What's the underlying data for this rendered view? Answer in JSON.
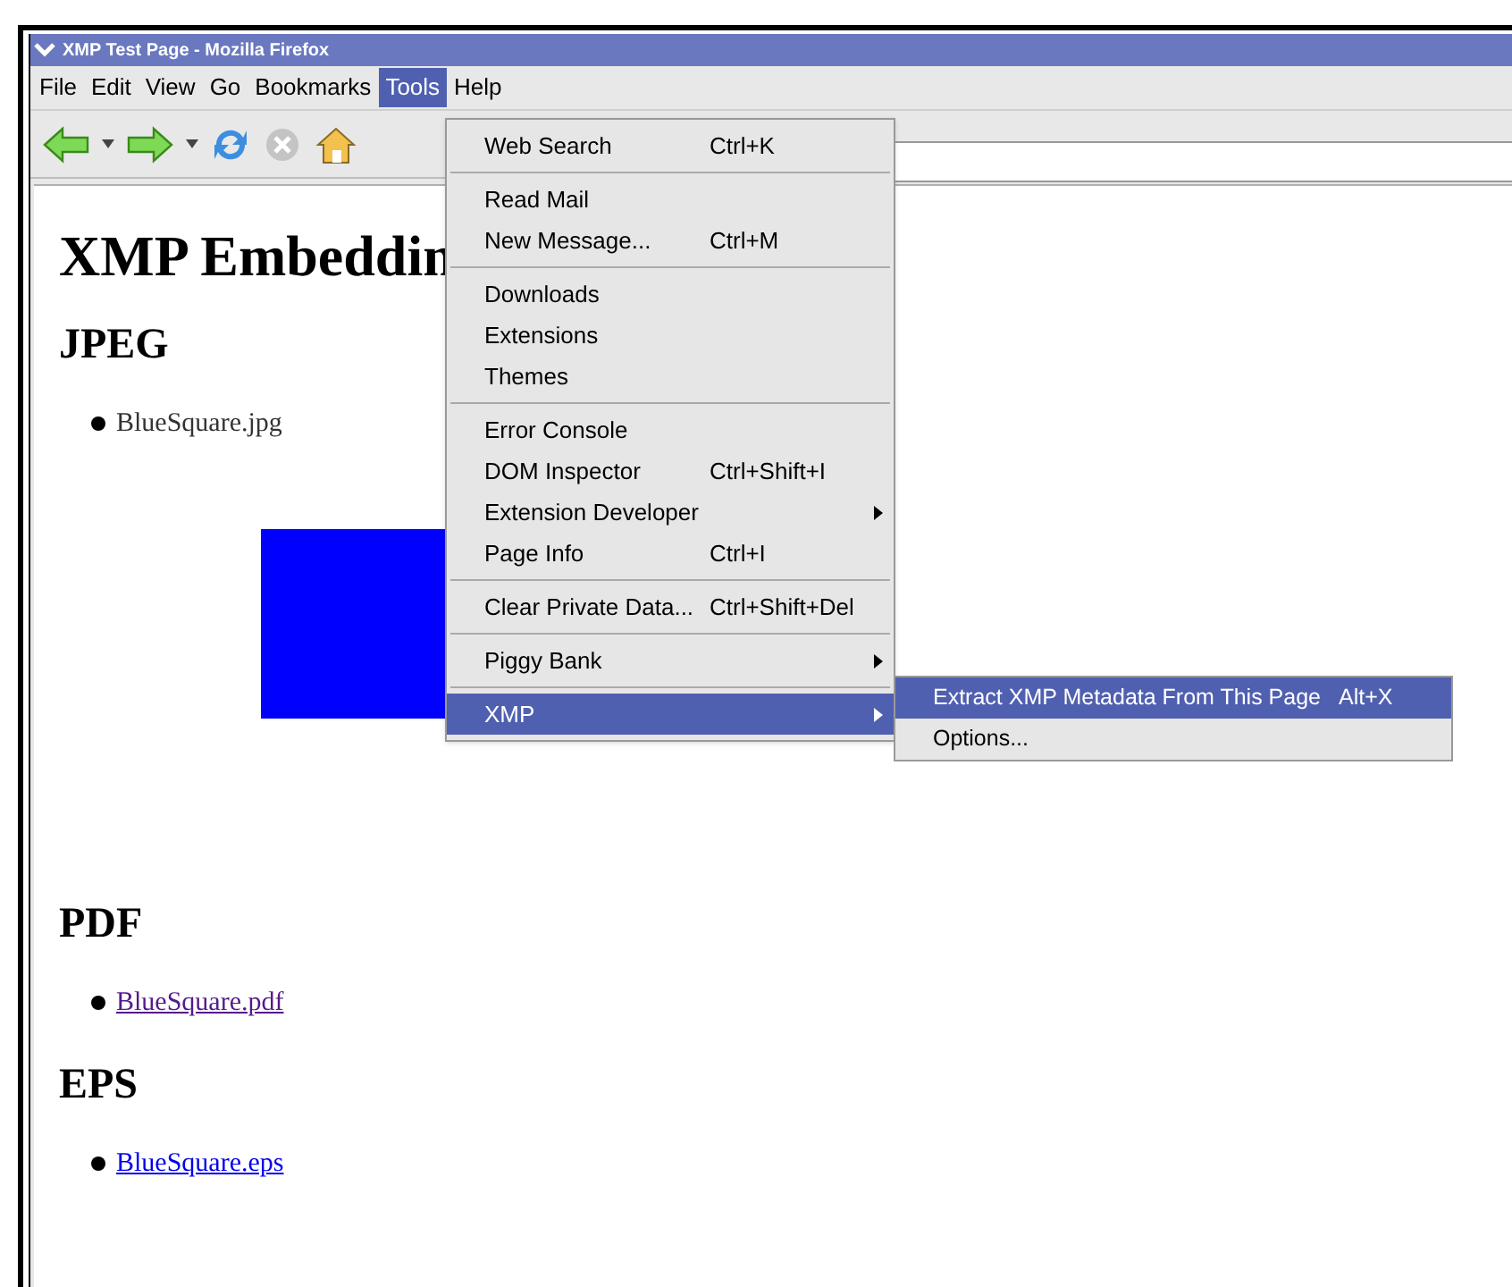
{
  "window": {
    "title": "XMP Test Page - Mozilla Firefox"
  },
  "menubar": [
    {
      "label": "File",
      "selected": false
    },
    {
      "label": "Edit",
      "selected": false
    },
    {
      "label": "View",
      "selected": false
    },
    {
      "label": "Go",
      "selected": false
    },
    {
      "label": "Bookmarks",
      "selected": false
    },
    {
      "label": "Tools",
      "selected": true
    },
    {
      "label": "Help",
      "selected": false
    }
  ],
  "toolbar": {
    "stop_disabled": true
  },
  "page": {
    "title": "XMP Embeddin",
    "sections": [
      {
        "heading": "JPEG",
        "item": {
          "text": "BlueSquare.jpg",
          "kind": "image",
          "visited": false
        }
      },
      {
        "heading": "PDF",
        "item": {
          "text": "BlueSquare.pdf",
          "kind": "link",
          "visited": true
        }
      },
      {
        "heading": "EPS",
        "item": {
          "text": "BlueSquare.eps",
          "kind": "link",
          "visited": false
        }
      }
    ]
  },
  "tools_menu": [
    {
      "kind": "item",
      "label": "Web Search",
      "shortcut": "Ctrl+K",
      "submenu": false,
      "selected": false
    },
    {
      "kind": "separator"
    },
    {
      "kind": "item",
      "label": "Read Mail",
      "submenu": false,
      "selected": false
    },
    {
      "kind": "item",
      "label": "New Message...",
      "shortcut": "Ctrl+M",
      "submenu": false,
      "selected": false
    },
    {
      "kind": "separator"
    },
    {
      "kind": "item",
      "label": "Downloads",
      "submenu": false,
      "selected": false
    },
    {
      "kind": "item",
      "label": "Extensions",
      "submenu": false,
      "selected": false
    },
    {
      "kind": "item",
      "label": "Themes",
      "submenu": false,
      "selected": false
    },
    {
      "kind": "separator"
    },
    {
      "kind": "item",
      "label": "Error Console",
      "submenu": false,
      "selected": false
    },
    {
      "kind": "item",
      "label": "DOM Inspector",
      "shortcut": "Ctrl+Shift+I",
      "submenu": false,
      "selected": false
    },
    {
      "kind": "item",
      "label": "Extension Developer",
      "submenu": true,
      "selected": false
    },
    {
      "kind": "item",
      "label": "Page Info",
      "shortcut": "Ctrl+I",
      "submenu": false,
      "selected": false
    },
    {
      "kind": "separator"
    },
    {
      "kind": "item",
      "label": "Clear Private Data...",
      "shortcut": "Ctrl+Shift+Del",
      "submenu": false,
      "selected": false
    },
    {
      "kind": "separator"
    },
    {
      "kind": "item",
      "label": "Piggy Bank",
      "submenu": true,
      "selected": false
    },
    {
      "kind": "separator"
    },
    {
      "kind": "item",
      "label": "XMP",
      "submenu": true,
      "selected": true
    }
  ],
  "xmp_submenu": [
    {
      "label": "Extract XMP Metadata From This Page",
      "shortcut": "Alt+X",
      "selected": true
    },
    {
      "label": "Options...",
      "selected": false
    }
  ]
}
